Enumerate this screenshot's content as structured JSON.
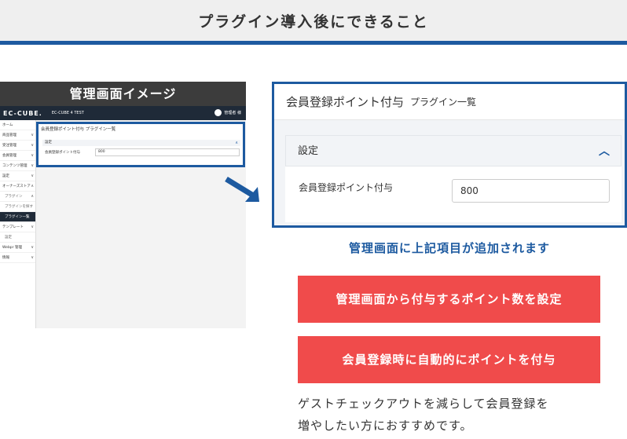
{
  "header": {
    "title": "プラグイン導入後にできること"
  },
  "mockup": {
    "caption": "管理画面イメージ",
    "logo": "EC-CUBE.",
    "shop_name": "EC-CUBE 4 TEST",
    "user": "管理者 様",
    "sidebar": [
      {
        "label": "ホーム",
        "chev": ""
      },
      {
        "label": "商品管理",
        "chev": "∨"
      },
      {
        "label": "受注管理",
        "chev": "∨"
      },
      {
        "label": "会員管理",
        "chev": "∨"
      },
      {
        "label": "コンテンツ管理",
        "chev": "∨"
      },
      {
        "label": "設定",
        "chev": "∨"
      },
      {
        "label": "オーナーズストア",
        "chev": "∧"
      },
      {
        "label": "プラグイン",
        "chev": "∧"
      },
      {
        "label": "プラグインを探す",
        "chev": ""
      },
      {
        "label": "プラグイン一覧",
        "chev": ""
      },
      {
        "label": "テンプレート",
        "chev": "∨"
      },
      {
        "label": "設定",
        "chev": ""
      },
      {
        "label": "Webpr 管理",
        "chev": "∨"
      },
      {
        "label": "情報",
        "chev": "∨"
      }
    ],
    "panel_title": "会員登録ポイント付与 プラグイン一覧",
    "section": "設定",
    "field_label": "会員登録ポイント付与",
    "field_value": "800"
  },
  "panel": {
    "title": "会員登録ポイント付与",
    "subtitle": "プラグイン一覧",
    "section": "設定",
    "collapse_icon": "chevron-up-icon",
    "field_label": "会員登録ポイント付与",
    "field_value": "800"
  },
  "caption": "管理画面に上記項目が追加されます",
  "buttons": {
    "b1": "管理画面から付与するポイント数を設定",
    "b2": "会員登録時に自動的にポイントを付与"
  },
  "description": {
    "line1": "ゲストチェックアウトを減らして会員登録を",
    "line2": "増やしたい方におすすめです。"
  },
  "colors": {
    "accent": "#1d5aa0",
    "button": "#f04b4b",
    "dark": "#1f2a38"
  }
}
